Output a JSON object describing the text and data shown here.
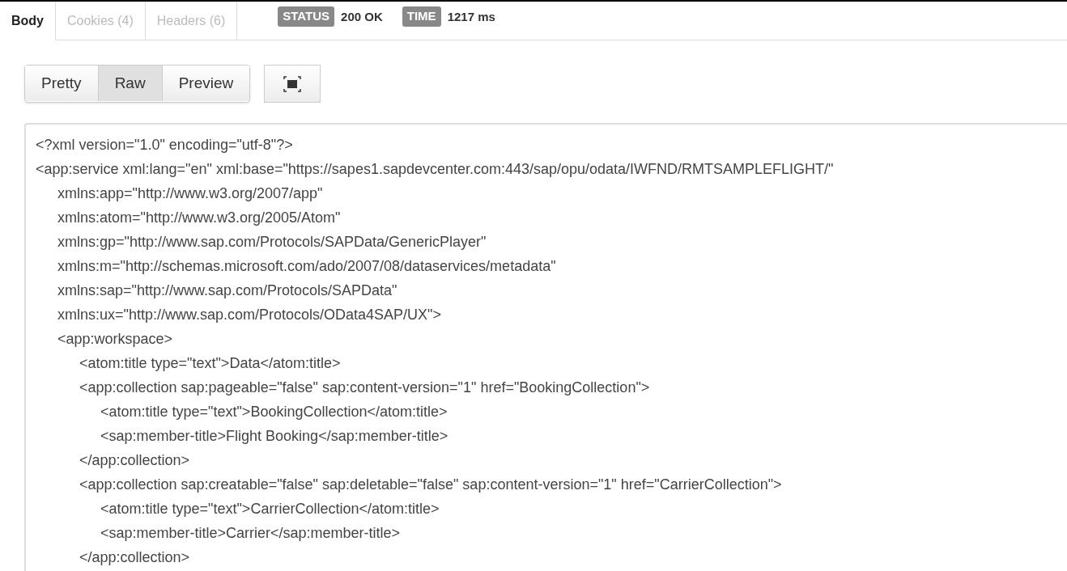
{
  "tabs": [
    {
      "label": "Body",
      "selected": true
    },
    {
      "label": "Cookies (4)",
      "selected": false
    },
    {
      "label": "Headers (6)",
      "selected": false
    }
  ],
  "status": {
    "label": "STATUS",
    "value": "200 OK"
  },
  "time": {
    "label": "TIME",
    "value": "1217 ms"
  },
  "view_modes": [
    {
      "label": "Pretty",
      "selected": false
    },
    {
      "label": "Raw",
      "selected": true
    },
    {
      "label": "Preview",
      "selected": false
    }
  ],
  "code_lines": [
    {
      "text": "<?xml version=\"1.0\" encoding=\"utf-8\"?>"
    },
    {
      "text": "<app:service xml:lang=\"en\" xml:base=\"https://sapes1.sapdevcenter.com:443/sap/opu/odata/IWFND/RMTSAMPLEFLIGHT/\"",
      "children": [
        {
          "text": "xmlns:app=\"http://www.w3.org/2007/app\""
        },
        {
          "text": "xmlns:atom=\"http://www.w3.org/2005/Atom\""
        },
        {
          "text": "xmlns:gp=\"http://www.sap.com/Protocols/SAPData/GenericPlayer\""
        },
        {
          "text": "xmlns:m=\"http://schemas.microsoft.com/ado/2007/08/dataservices/metadata\""
        },
        {
          "text": "xmlns:sap=\"http://www.sap.com/Protocols/SAPData\""
        },
        {
          "text": "xmlns:ux=\"http://www.sap.com/Protocols/OData4SAP/UX\">"
        },
        {
          "text": "<app:workspace>",
          "children": [
            {
              "text": "<atom:title type=\"text\">Data</atom:title>"
            },
            {
              "text": "<app:collection sap:pageable=\"false\" sap:content-version=\"1\" href=\"BookingCollection\">",
              "children": [
                {
                  "text": "<atom:title type=\"text\">BookingCollection</atom:title>"
                },
                {
                  "text": "<sap:member-title>Flight Booking</sap:member-title>"
                }
              ]
            },
            {
              "text": "</app:collection>"
            },
            {
              "text": "<app:collection sap:creatable=\"false\" sap:deletable=\"false\" sap:content-version=\"1\" href=\"CarrierCollection\">",
              "children": [
                {
                  "text": "<atom:title type=\"text\">CarrierCollection</atom:title>"
                },
                {
                  "text": "<sap:member-title>Carrier</sap:member-title>"
                }
              ]
            },
            {
              "text": "</app:collection>"
            }
          ]
        }
      ]
    }
  ]
}
